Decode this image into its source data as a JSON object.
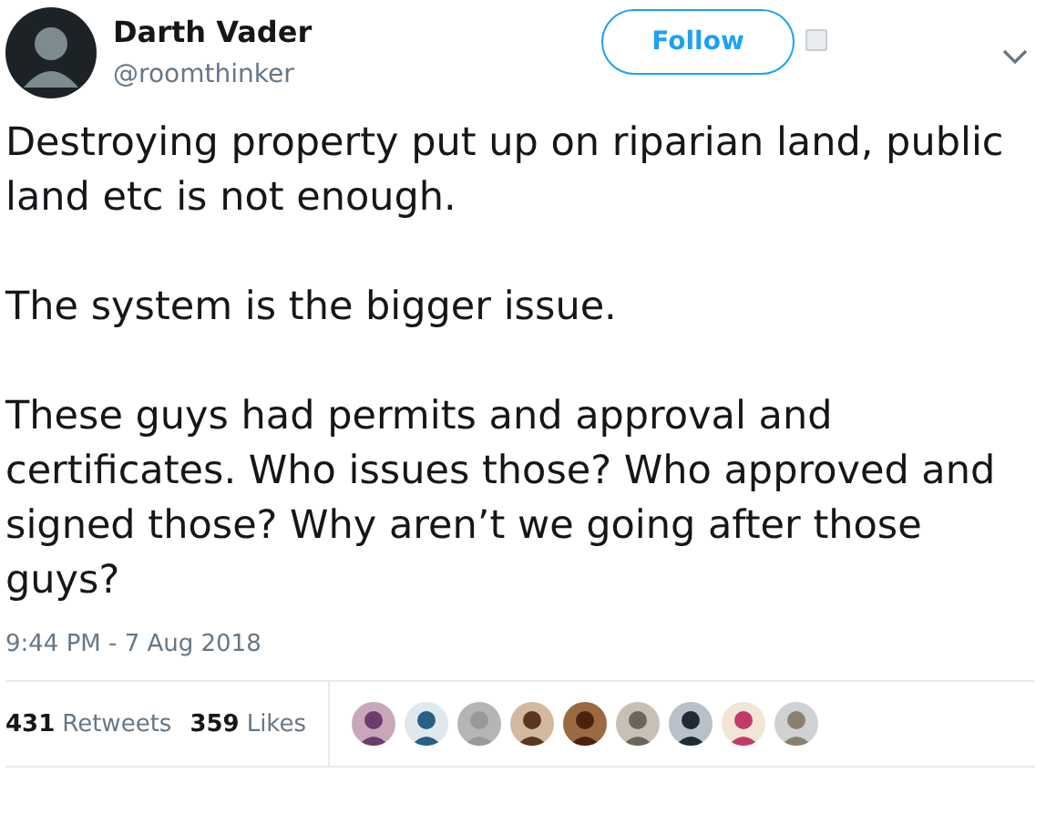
{
  "author": {
    "name": "Darth Vader",
    "handle": "@roomthinker"
  },
  "follow_button": {
    "label": "Follow"
  },
  "paragraphs": [
    "Destroying property put up on riparian land, public land etc is not enough.",
    "The system is the bigger issue.",
    "These guys had permits and approval and certificates. Who issues those? Who approved and signed those? Why aren’t we going after those guys?"
  ],
  "timestamp": "9:44 PM - 7 Aug 2018",
  "stats": [
    {
      "count": "431",
      "label": "Retweets"
    },
    {
      "count": "359",
      "label": "Likes"
    }
  ]
}
